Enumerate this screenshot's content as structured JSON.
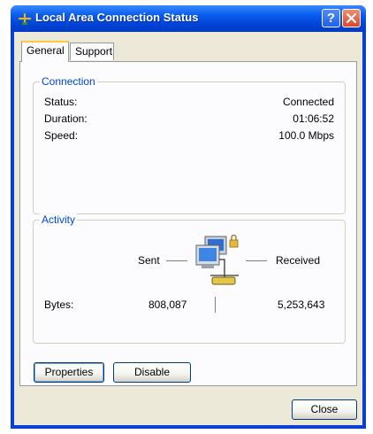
{
  "window": {
    "title": "Local Area Connection Status",
    "title_icon": "network-connection-icon",
    "help_label": "?"
  },
  "tabs": [
    {
      "label": "General",
      "active": true
    },
    {
      "label": "Support",
      "active": false
    }
  ],
  "connection": {
    "label": "Connection",
    "rows": [
      {
        "key": "Status:",
        "value": "Connected"
      },
      {
        "key": "Duration:",
        "value": "01:06:52"
      },
      {
        "key": "Speed:",
        "value": "100.0 Mbps"
      }
    ]
  },
  "activity": {
    "label": "Activity",
    "sent_label": "Sent",
    "received_label": "Received",
    "icon": "network-activity-icon",
    "bytes_label": "Bytes:",
    "bytes_sent": "808,087",
    "bytes_received": "5,253,643"
  },
  "buttons": {
    "properties": "Properties",
    "disable": "Disable",
    "close": "Close"
  },
  "colors": {
    "titlebar": "#0054e3",
    "group_label": "#0046d5",
    "dialog_bg": "#ece9d8"
  }
}
